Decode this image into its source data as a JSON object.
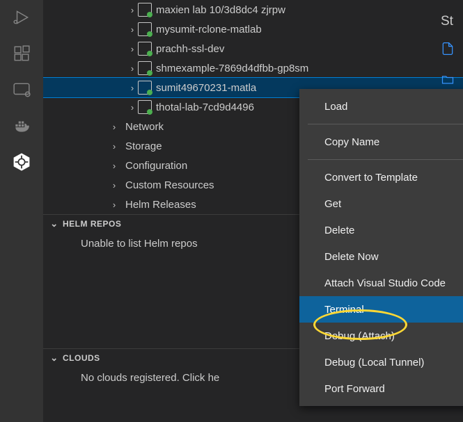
{
  "tree": {
    "pods": [
      {
        "label": "maxien lab 10/3d8dc4 zjrpw",
        "selected": false,
        "indent": 120
      },
      {
        "label": "mysumit-rclone-matlab",
        "selected": false,
        "indent": 120
      },
      {
        "label": "prachh-ssl-dev",
        "selected": false,
        "indent": 120
      },
      {
        "label": "shmexample-7869d4dfbb-gp8sm",
        "selected": false,
        "indent": 120
      },
      {
        "label": "sumit49670231-matla",
        "selected": true,
        "indent": 120
      },
      {
        "label": "thotal-lab-7cd9d4496",
        "selected": false,
        "indent": 120
      }
    ],
    "categories": [
      {
        "label": "Network",
        "indent": 94
      },
      {
        "label": "Storage",
        "indent": 94
      },
      {
        "label": "Configuration",
        "indent": 94
      },
      {
        "label": "Custom Resources",
        "indent": 94
      },
      {
        "label": "Helm Releases",
        "indent": 94
      }
    ]
  },
  "sections": {
    "helm_repos": {
      "title": "HELM REPOS",
      "message": "Unable to list Helm repos"
    },
    "clouds": {
      "title": "CLOUDS",
      "message": "No clouds registered. Click he"
    }
  },
  "context_menu": {
    "groups": [
      [
        "Load"
      ],
      [
        "Copy Name"
      ],
      [
        "Convert to Template",
        "Get",
        "Delete",
        "Delete Now",
        "Attach Visual Studio Code",
        "Terminal",
        "Debug (Attach)",
        "Debug (Local Tunnel)",
        "Port Forward"
      ]
    ],
    "highlighted": "Terminal"
  },
  "right_edge": {
    "text": "St"
  }
}
